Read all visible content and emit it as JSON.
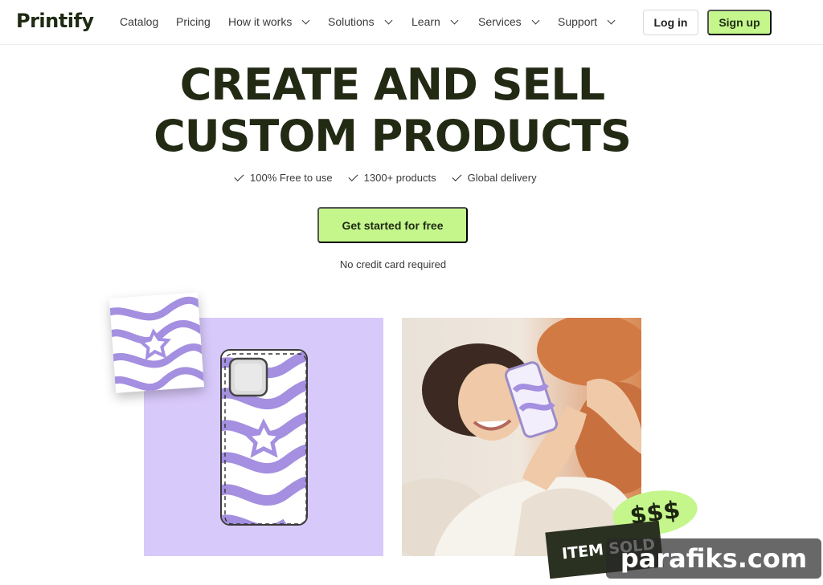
{
  "brand": {
    "logo_text": "Printify",
    "accent_color": "#c4f68c",
    "headline_color": "#232a14"
  },
  "nav": {
    "items": [
      {
        "label": "Catalog",
        "dropdown": false
      },
      {
        "label": "Pricing",
        "dropdown": false
      },
      {
        "label": "How it works",
        "dropdown": true
      },
      {
        "label": "Solutions",
        "dropdown": true
      },
      {
        "label": "Learn",
        "dropdown": true
      },
      {
        "label": "Services",
        "dropdown": true
      },
      {
        "label": "Support",
        "dropdown": true
      }
    ],
    "login_label": "Log in",
    "signup_label": "Sign up"
  },
  "hero": {
    "headline_line1": "CREATE AND SELL",
    "headline_line2": "CUSTOM PRODUCTS",
    "features": [
      "100% Free to use",
      "1300+ products",
      "Global delivery"
    ],
    "cta_label": "Get started for free",
    "cta_note": "No credit card required"
  },
  "visual": {
    "bubble_text": "$$$",
    "sold_badge": "ITEM SOLD",
    "panel_color": "#d8c9fb",
    "pattern_color": "#a48fe0"
  },
  "watermark": {
    "text": "parafiks.com"
  }
}
